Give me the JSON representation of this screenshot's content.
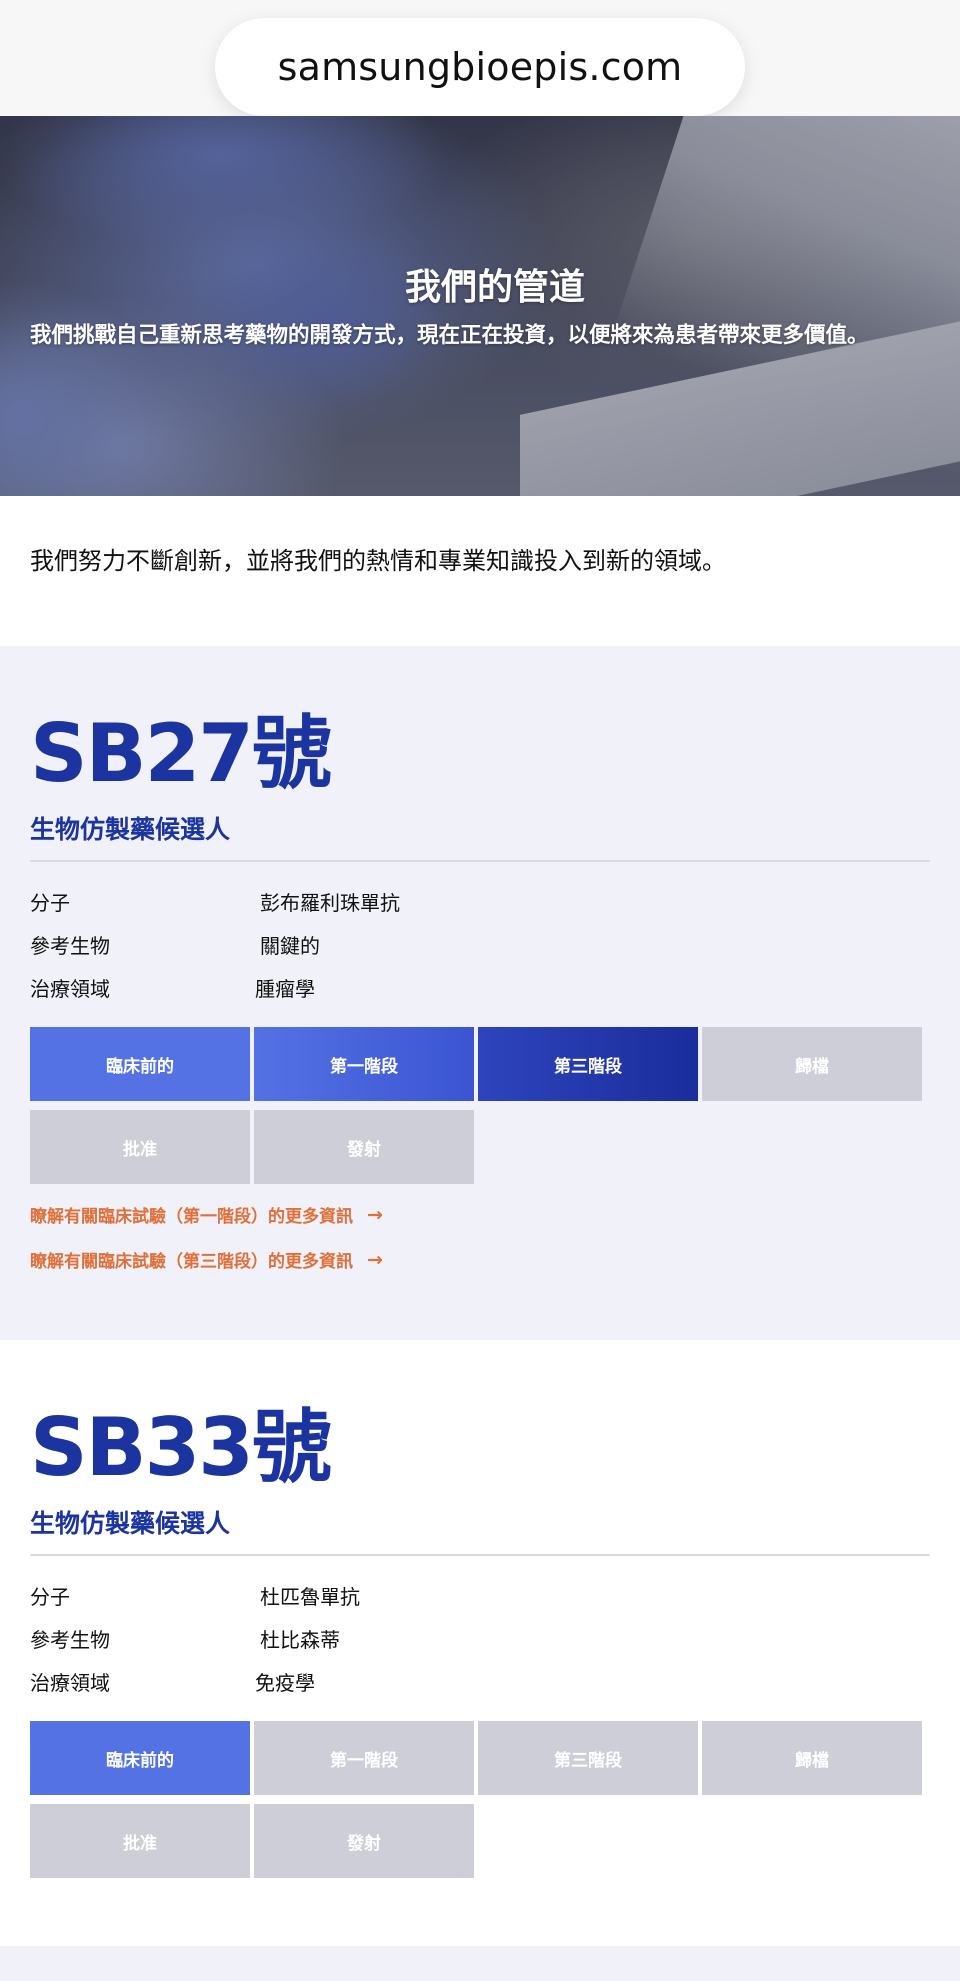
{
  "browser": {
    "url": "samsungbioepis.com"
  },
  "hero": {
    "title": "我們的管道",
    "subtitle": "我們挑戰自己重新思考藥物的開發方式，現在正在投資，以便將來為患者帶來更多價值。"
  },
  "intro": "我們努力不斷創新，並將我們的熱情和專業知識投入到新的領域。",
  "labels": {
    "molecule": "分子",
    "reference": "參考生物",
    "therapeutic_area": "治療領域"
  },
  "products": [
    {
      "code": "SB27號",
      "type": "生物仿製藥候選人",
      "molecule": "彭布羅利珠單抗",
      "reference": "關鍵的",
      "therapeutic_area": "腫瘤學",
      "stages": [
        {
          "label": "臨床前的",
          "state": "done"
        },
        {
          "label": "第一階段",
          "state": "done"
        },
        {
          "label": "第三階段",
          "state": "current"
        },
        {
          "label": "歸檔",
          "state": "inactive"
        },
        {
          "label": "批准",
          "state": "inactive"
        },
        {
          "label": "發射",
          "state": "inactive"
        }
      ],
      "links": [
        "瞭解有關臨床試驗（第一階段）的更多資訊",
        "瞭解有關臨床試驗（第三階段）的更多資訊"
      ]
    },
    {
      "code": "SB33號",
      "type": "生物仿製藥候選人",
      "molecule": "杜匹魯單抗",
      "reference": "杜比森蒂",
      "therapeutic_area": "免疫學",
      "stages": [
        {
          "label": "臨床前的",
          "state": "current"
        },
        {
          "label": "第一階段",
          "state": "inactive"
        },
        {
          "label": "第三階段",
          "state": "inactive"
        },
        {
          "label": "歸檔",
          "state": "inactive"
        },
        {
          "label": "批准",
          "state": "inactive"
        },
        {
          "label": "發射",
          "state": "inactive"
        }
      ]
    }
  ],
  "colors": {
    "brand_blue": "#1c34a0",
    "stage_active": "#5472e4",
    "stage_inactive": "#cdced8",
    "link_orange": "#e0703a",
    "section_bg": "#f0f1f9"
  }
}
